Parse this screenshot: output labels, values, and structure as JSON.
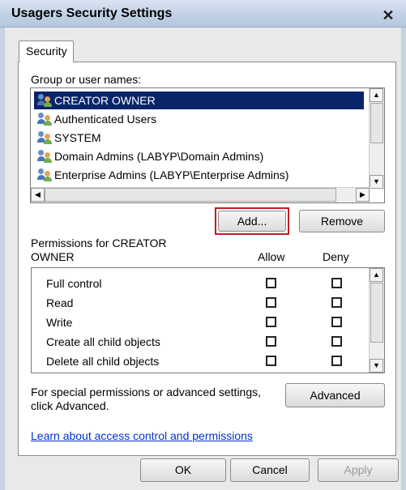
{
  "window": {
    "title": "Usagers Security Settings",
    "close_glyph": "✕"
  },
  "tabs": [
    {
      "label": "Security"
    }
  ],
  "groups": {
    "label": "Group or user names:",
    "items": [
      {
        "name": "CREATOR OWNER",
        "selected": true,
        "icon": "user-group-icon"
      },
      {
        "name": "Authenticated Users",
        "selected": false,
        "icon": "user-group-icon"
      },
      {
        "name": "SYSTEM",
        "selected": false,
        "icon": "user-group-icon"
      },
      {
        "name": "Domain Admins (LABYP\\Domain Admins)",
        "selected": false,
        "icon": "user-group-icon"
      },
      {
        "name": "Enterprise Admins (LABYP\\Enterprise Admins)",
        "selected": false,
        "icon": "user-group-icon"
      }
    ]
  },
  "buttons": {
    "add": "Add...",
    "remove": "Remove",
    "advanced": "Advanced",
    "ok": "OK",
    "cancel": "Cancel",
    "apply": "Apply"
  },
  "permissions": {
    "label_line1": "Permissions for CREATOR",
    "label_line2": "OWNER",
    "allow_header": "Allow",
    "deny_header": "Deny",
    "rows": [
      {
        "name": "Full control",
        "allow": false,
        "deny": false
      },
      {
        "name": "Read",
        "allow": false,
        "deny": false
      },
      {
        "name": "Write",
        "allow": false,
        "deny": false
      },
      {
        "name": "Create all child objects",
        "allow": false,
        "deny": false
      },
      {
        "name": "Delete all child objects",
        "allow": false,
        "deny": false
      }
    ]
  },
  "advanced_note": {
    "line1": "For special permissions or advanced settings,",
    "line2": "click Advanced."
  },
  "help_link": "Learn about access control and permissions",
  "colors": {
    "selection": "#0a246a",
    "highlight_border": "#c41c24",
    "link": "#0033cc",
    "titlebar": "#c3d3e6"
  }
}
